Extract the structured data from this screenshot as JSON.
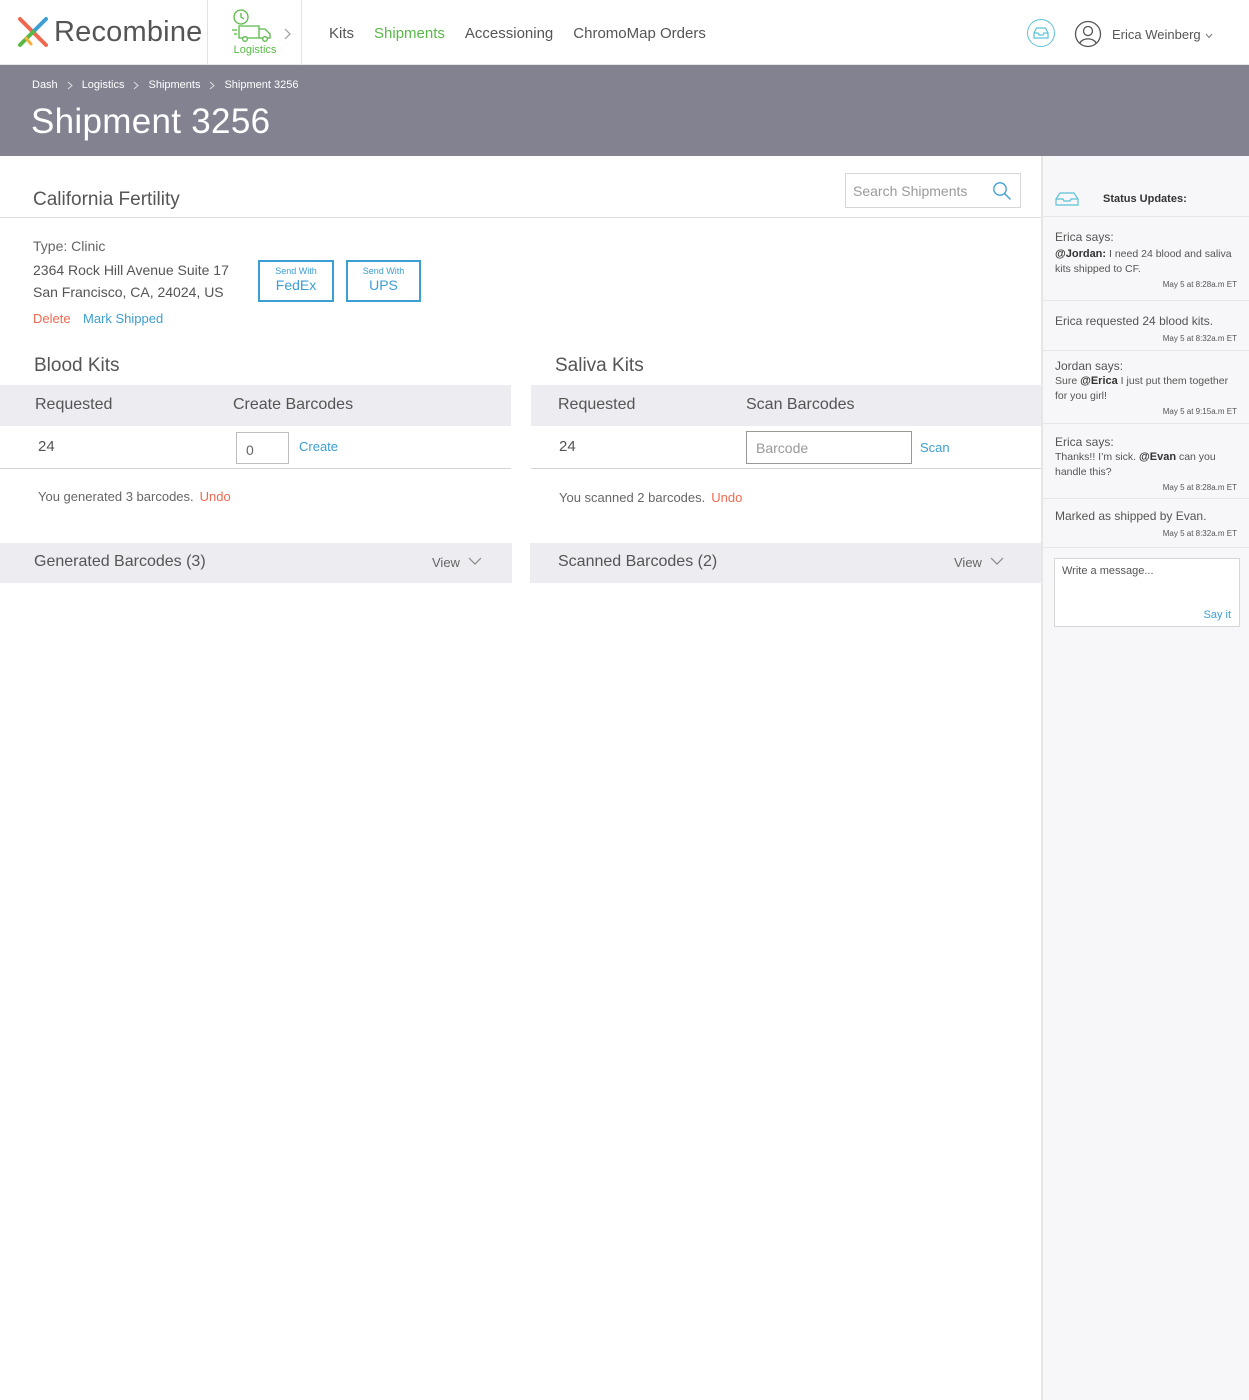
{
  "app": {
    "brand": "Recombine",
    "module_label": "Logistics",
    "nav": [
      "Kits",
      "Shipments",
      "Accessioning",
      "ChromoMap Orders"
    ],
    "active_nav": "Shipments",
    "user_name": "Erica Weinberg",
    "colors": {
      "accent_green": "#58b947",
      "link_blue": "#3b9fd4",
      "danger": "#ef6950",
      "band": "#828291"
    }
  },
  "breadcrumb": [
    "Dash",
    "Logistics",
    "Shipments",
    "Shipment 3256"
  ],
  "page_title": "Shipment 3256",
  "search": {
    "placeholder": "Search Shipments"
  },
  "shipment": {
    "client": "California Fertility",
    "type": "Type: Clinic",
    "address_line1": "2364 Rock Hill Avenue Suite 17",
    "address_line2": "San Francisco, CA, 24024, US",
    "delete_label": "Delete",
    "mark_shipped_label": "Mark Shipped",
    "send_with_label": "Send With",
    "carriers": [
      "FedEx",
      "UPS"
    ]
  },
  "blood_kits": {
    "title": "Blood Kits",
    "col_requested": "Requested",
    "col_action": "Create Barcodes",
    "requested": "24",
    "quantity_value": "0",
    "action_label": "Create",
    "note": "You generated 3 barcodes.",
    "undo_label": "Undo",
    "accordion_title": "Generated Barcodes (3)",
    "view_label": "View"
  },
  "saliva_kits": {
    "title": "Saliva Kits",
    "col_requested": "Requested",
    "col_action": "Scan Barcodes",
    "requested": "24",
    "barcode_placeholder": "Barcode",
    "action_label": "Scan",
    "note": "You scanned 2 barcodes.",
    "undo_label": "Undo",
    "accordion_title": "Scanned Barcodes (2)",
    "view_label": "View"
  },
  "status_panel": {
    "title": "Status Updates:",
    "messages": [
      {
        "author": "Erica says:",
        "mention": "@Jordan:",
        "text": " I need 24 blood and saliva kits shipped to CF.",
        "time": "May 5 at 8:28a.m ET"
      },
      {
        "author": "Erica requested 24 blood kits.",
        "time": "May 5 at 8:32a.m ET"
      },
      {
        "author": "Jordan says:",
        "prefix": "Sure ",
        "mention": "@Erica",
        "text": " I just put them together for you girl!",
        "time": "May 5 at 9:15a.m ET"
      },
      {
        "author": "Erica says:",
        "prefix": "Thanks!! I’m sick. ",
        "mention": "@Evan",
        "text": " can you handle this?",
        "time": "May 5 at 8:28a.m ET"
      },
      {
        "author": "Marked as shipped by Evan.",
        "time": "May 5 at 8:32a.m ET"
      }
    ],
    "compose_placeholder": "Write a message...",
    "send_label": "Say it"
  }
}
